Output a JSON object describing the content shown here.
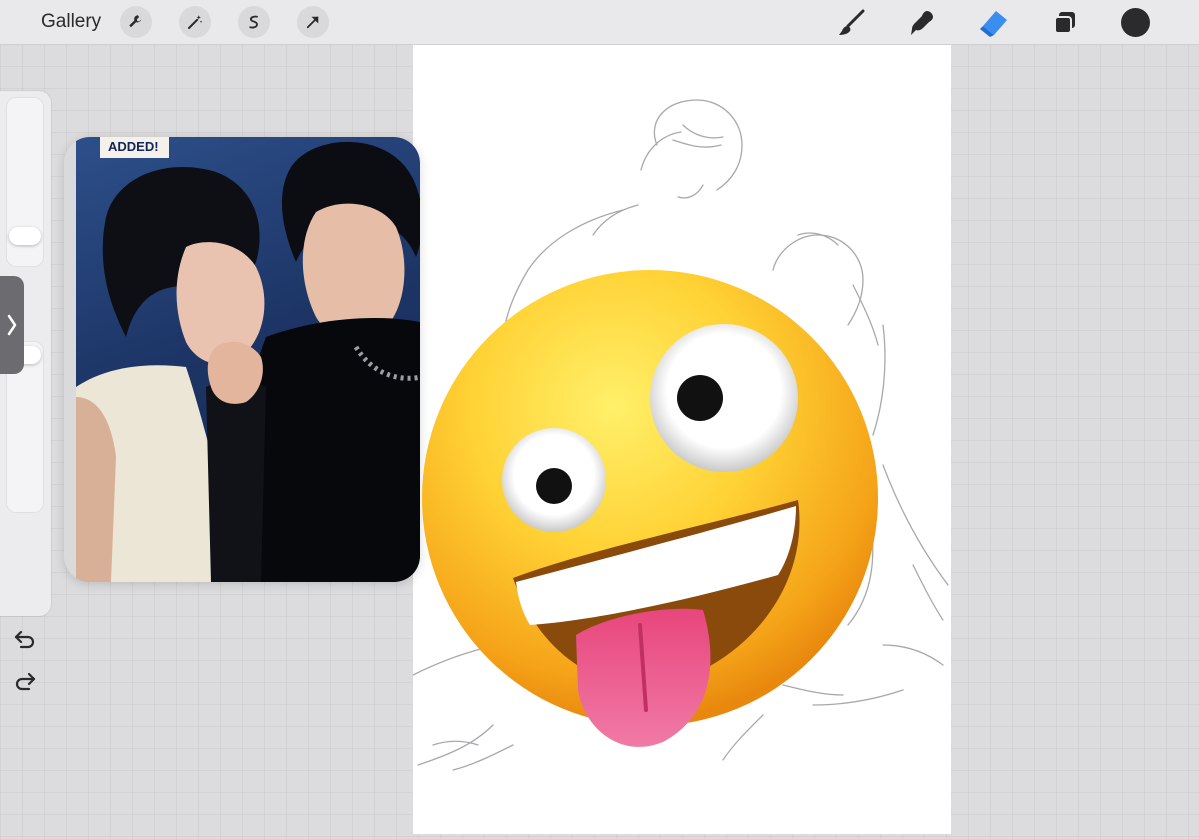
{
  "toolbar": {
    "gallery_label": "Gallery",
    "left_tools": [
      "actions-wrench-icon",
      "adjustments-wand-icon",
      "selection-icon",
      "transform-arrow-icon"
    ],
    "right_tools": [
      "brush-icon",
      "smudge-icon",
      "eraser-icon",
      "layers-icon",
      "color-picker"
    ],
    "active_tool": "eraser",
    "active_color": "#2b2b2e",
    "accent": "#3a8ef0"
  },
  "reference": {
    "badge_text": "ADDED!"
  },
  "overlay": {
    "emoji": "zany-face"
  }
}
